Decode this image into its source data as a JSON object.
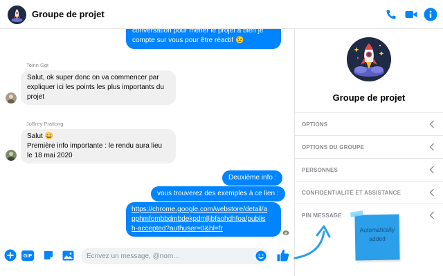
{
  "header": {
    "title": "Groupe de projet",
    "icons": [
      "phone-icon",
      "video-camera-icon",
      "info-icon"
    ]
  },
  "conversation": {
    "top_message": [
      "conversation pour mener le projet à bien je",
      "compte sur vous pour être réactif 😉"
    ],
    "messages": [
      {
        "sender": "Toinn Ggt",
        "lines": [
          "Salut, ok super donc on va commencer par",
          "expliquer ici les points les plus importants du",
          "projet"
        ]
      },
      {
        "sender": "JoBrey Pratlong",
        "lines": [
          "Salut 😀",
          "Première info importante : le rendu aura lieu",
          "le 18 mai 2020"
        ]
      }
    ],
    "outgoing": [
      "Deuxième info :",
      "vous trouverez des exemples à ce lien :"
    ],
    "link_lines": [
      "https://chrome.google.com/webstore/detail/a",
      "pphmfombbdmbdekpdmlljbfaohdhfoa/publis",
      "h-accepted?authuser=0&hl=fr"
    ]
  },
  "composer": {
    "placeholder": "Écrivez un message, @nom…",
    "gif_label": "GIF"
  },
  "side_panel": {
    "title": "Groupe de projet",
    "menu": [
      "OPTIONS",
      "OPTIONS DU GROUPE",
      "PERSONNES",
      "CONFIDENTIALITÉ ET ASSISTANCE",
      "PIN MESSAGE"
    ]
  },
  "annotation": {
    "note_lines": [
      "Automatically",
      "added"
    ]
  },
  "colors": {
    "accent": "#0084ff",
    "avatar_bg": "#1f2a44",
    "sticky": "#2b9fe9"
  }
}
